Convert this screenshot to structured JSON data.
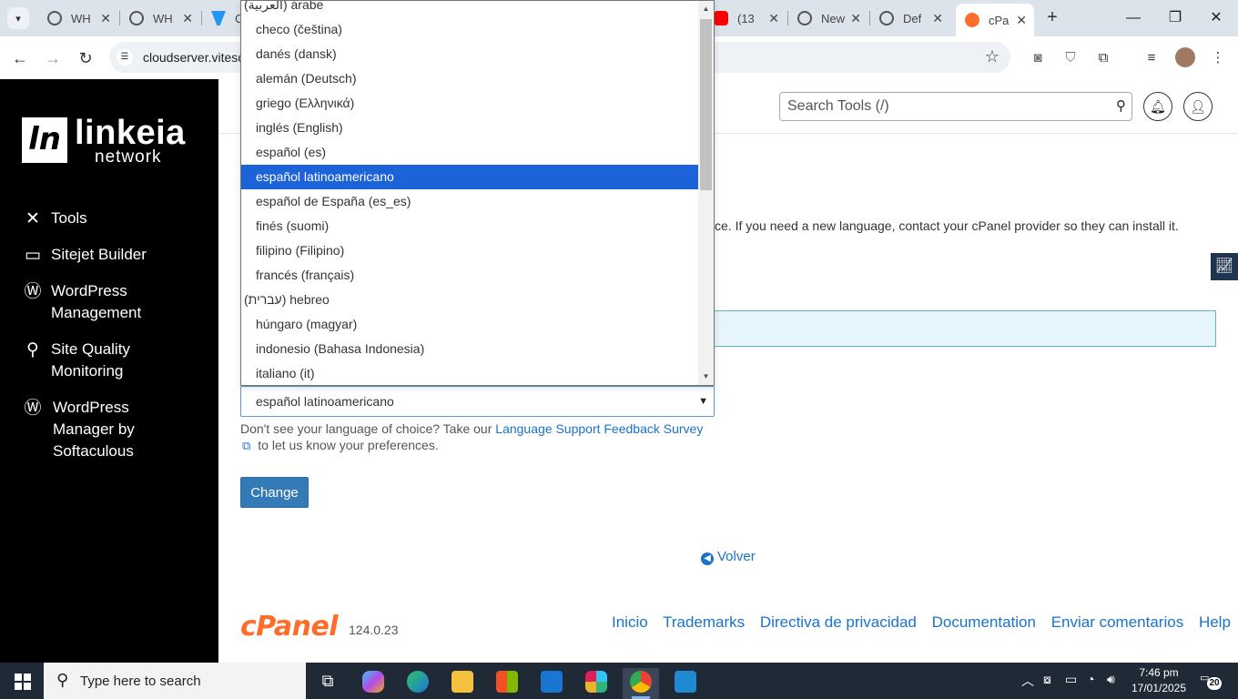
{
  "browser": {
    "tabs": [
      {
        "label": "WH",
        "favicon": "globe-icon"
      },
      {
        "label": "WH",
        "favicon": "globe-icon"
      },
      {
        "label": "C",
        "favicon": "vite-icon"
      },
      {
        "label": "(13",
        "favicon": "youtube-icon"
      },
      {
        "label": "New",
        "favicon": "globe-icon"
      },
      {
        "label": "Def",
        "favicon": "globe-icon"
      },
      {
        "label": "cPa",
        "favicon": "cpanel-icon"
      }
    ],
    "url": "cloudserver.vitesc"
  },
  "sidebar": {
    "logo_mark": "ln",
    "logo_name": "linkeia",
    "logo_sub": "network",
    "items": [
      {
        "label": "Tools",
        "icon": "tools-icon"
      },
      {
        "label": "Sitejet Builder",
        "icon": "sitejet-icon"
      },
      {
        "label": "WordPress Management",
        "icon": "wordpress-icon"
      },
      {
        "label": "Site Quality Monitoring",
        "icon": "site-quality-icon"
      },
      {
        "label": "WordPress Manager by Softaculous",
        "icon": "wordpress-icon"
      }
    ]
  },
  "header": {
    "search_placeholder": "Search Tools (/)"
  },
  "main": {
    "description": "ce. If you need a new language, contact your cPanel provider so they can install it.",
    "selected_language": "español latinoamericano",
    "help_text_before": "Don't see your language of choice? Take our ",
    "help_link": "Language Support Feedback Survey",
    "help_text_after": "to let us know your preferences.",
    "change_button": "Change",
    "back_link": "Volver"
  },
  "dropdown": {
    "options": [
      {
        "label": "(العربية) árabe",
        "rtl": true
      },
      {
        "label": "checo (čeština)"
      },
      {
        "label": "danés (dansk)"
      },
      {
        "label": "alemán (Deutsch)"
      },
      {
        "label": "griego (Ελληνικά)"
      },
      {
        "label": "inglés (English)"
      },
      {
        "label": "español (es)"
      },
      {
        "label": "español latinoamericano",
        "selected": true
      },
      {
        "label": "español de España (es_es)"
      },
      {
        "label": "finés (suomi)"
      },
      {
        "label": "filipino (Filipino)"
      },
      {
        "label": "francés (français)"
      },
      {
        "label": "(עברית) hebreo",
        "rtl": true
      },
      {
        "label": "húngaro (magyar)"
      },
      {
        "label": "indonesio (Bahasa Indonesia)"
      },
      {
        "label": "italiano (it)"
      }
    ]
  },
  "footer": {
    "brand": "cPanel",
    "version": "124.0.23",
    "links": [
      "Inicio",
      "Trademarks",
      "Directiva de privacidad",
      "Documentation",
      "Enviar comentarios",
      "Help"
    ]
  },
  "taskbar": {
    "search_placeholder": "Type here to search",
    "time": "7:46 pm",
    "date": "17/01/2025",
    "notification_count": "20"
  },
  "colors": {
    "accent": "#1c62d8",
    "link": "#1a73c9",
    "cpanel_orange": "#ff6c2c",
    "sidebar_bg": "#000000",
    "button_blue": "#337ab7"
  }
}
